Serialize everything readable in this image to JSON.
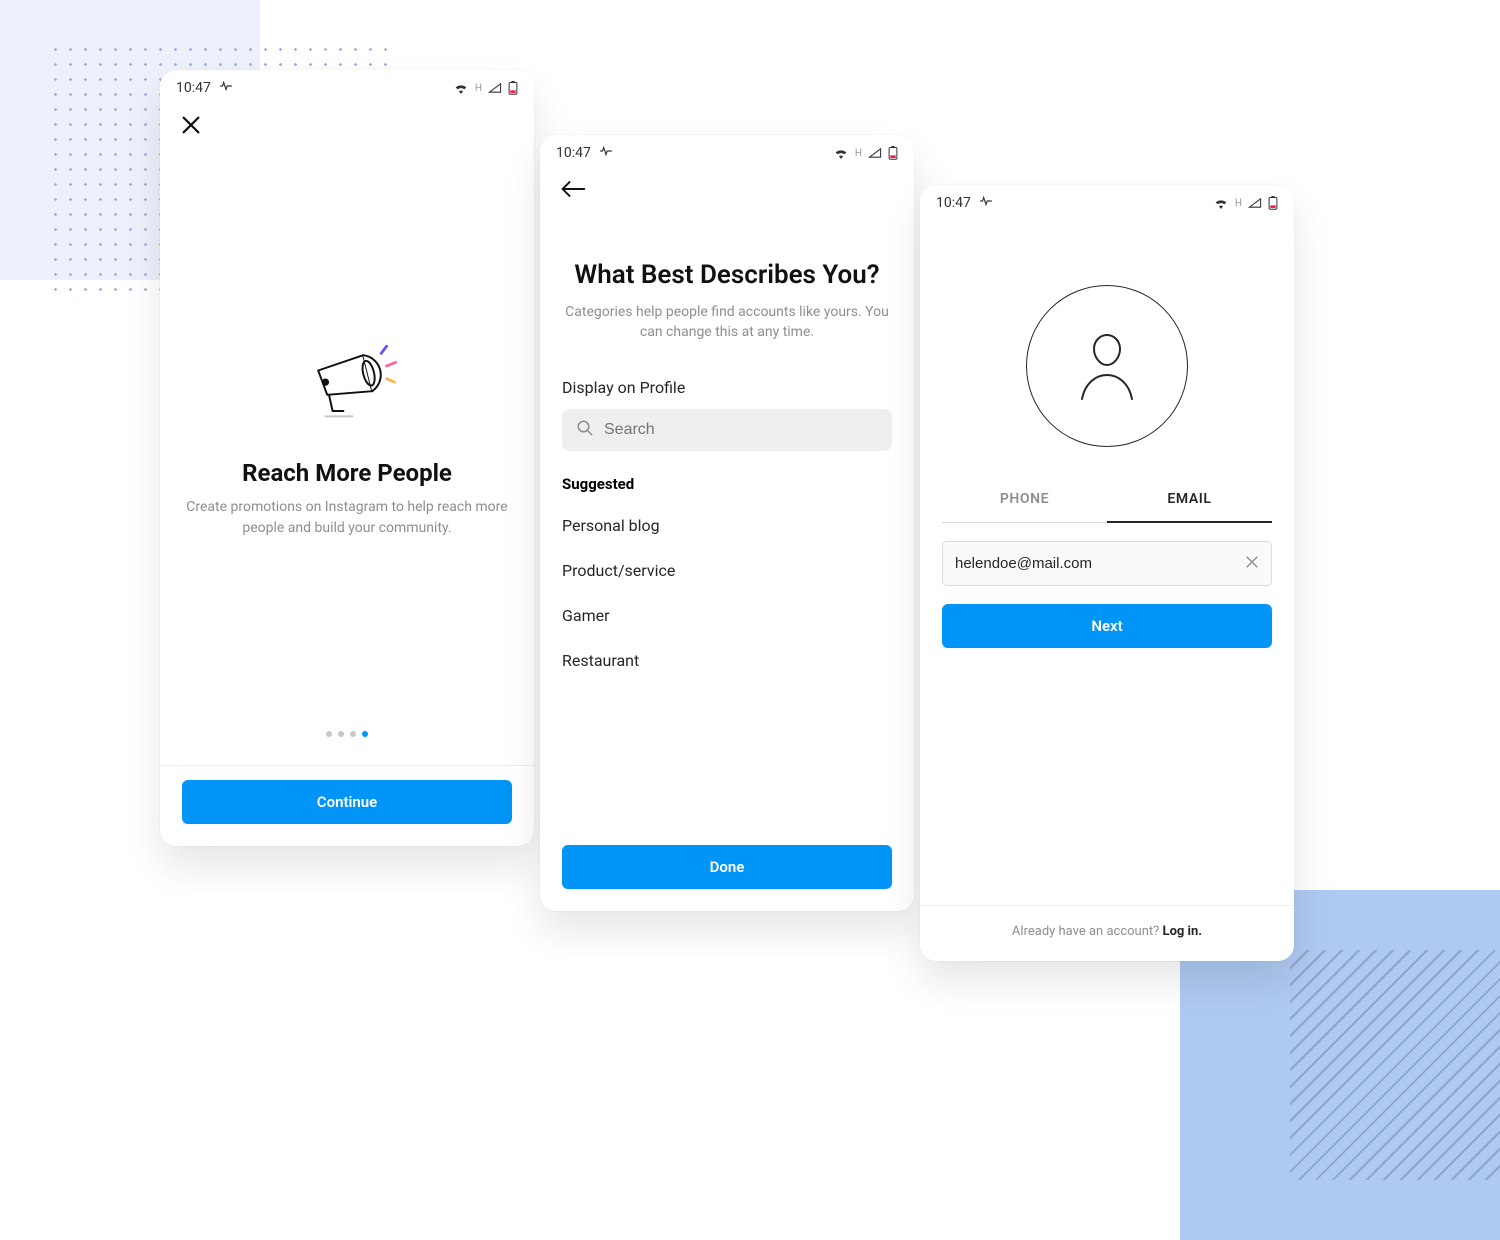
{
  "statusbar": {
    "time": "10:47",
    "net_label": "H"
  },
  "phone1": {
    "title": "Reach More People",
    "subtitle": "Create promotions on Instagram to help reach more people and build your community.",
    "cta": "Continue"
  },
  "phone2": {
    "title": "What Best Describes You?",
    "subtitle": "Categories help people find accounts like yours. You can change this at any time.",
    "display_label": "Display on Profile",
    "search_placeholder": "Search",
    "suggested_label": "Suggested",
    "categories": {
      "0": "Personal blog",
      "1": "Product/service",
      "2": "Gamer",
      "3": "Restaurant"
    },
    "cta": "Done"
  },
  "phone3": {
    "tab_phone": "PHONE",
    "tab_email": "EMAIL",
    "email_value": "helendoe@mail.com",
    "cta": "Next",
    "footer_q": "Already have an account? ",
    "footer_login": "Log in."
  }
}
